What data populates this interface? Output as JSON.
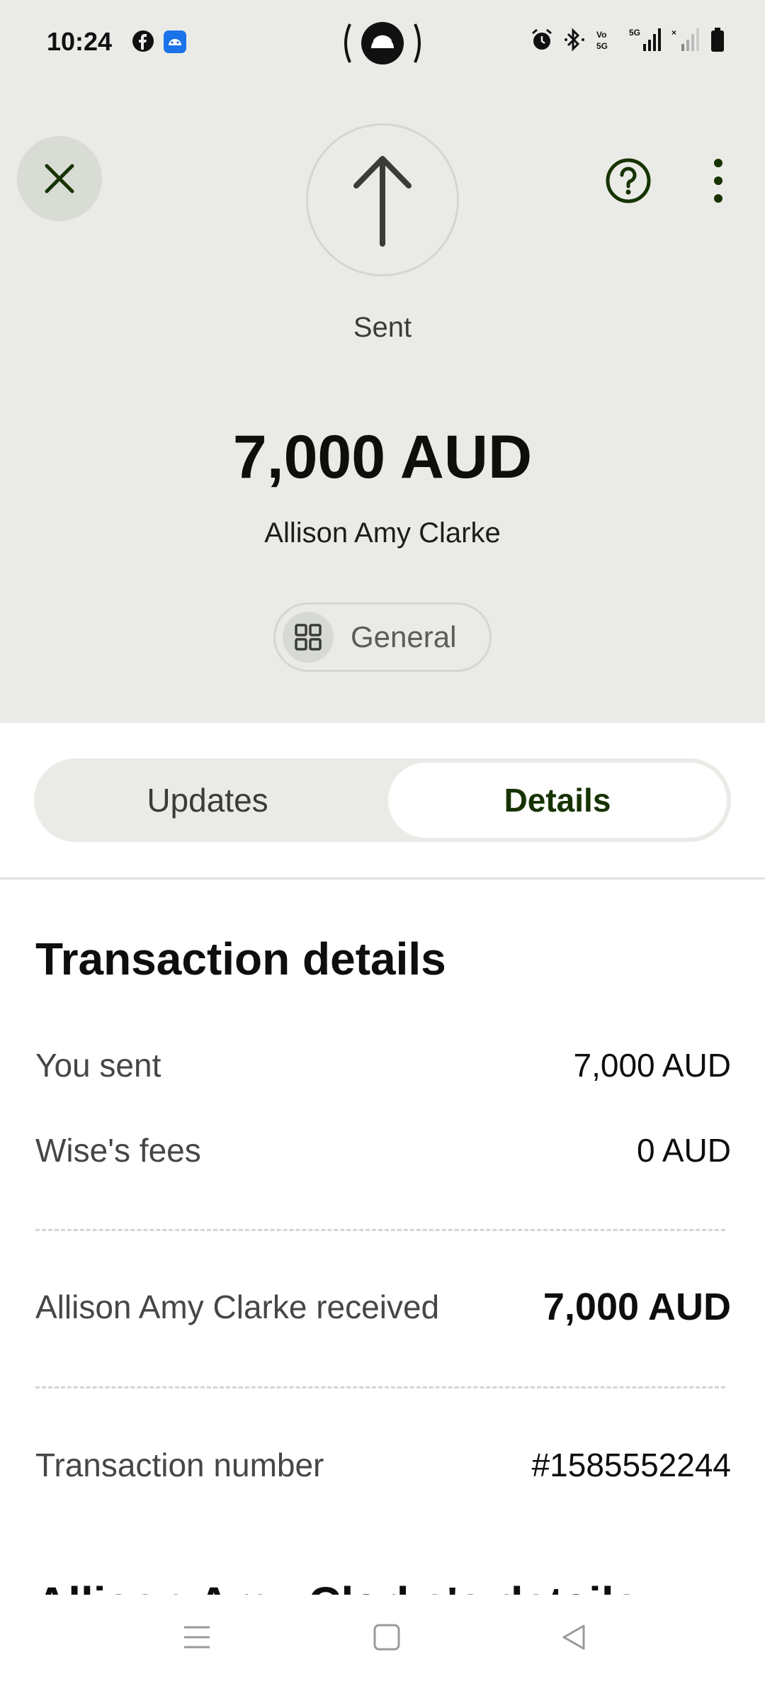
{
  "status_bar": {
    "time": "10:24",
    "icons": [
      "facebook-icon",
      "android-app-icon",
      "hotspot-icon",
      "alarm-icon",
      "bluetooth-icon",
      "volte-icon",
      "5g-signal-icon",
      "signal-icon",
      "battery-icon"
    ]
  },
  "header": {
    "status_label": "Sent",
    "amount": "7,000 AUD",
    "recipient": "Allison Amy Clarke",
    "category": "General"
  },
  "tabs": [
    {
      "label": "Updates",
      "selected": false
    },
    {
      "label": "Details",
      "selected": true
    }
  ],
  "details": {
    "title": "Transaction details",
    "rows": [
      {
        "label": "You sent",
        "value": "7,000 AUD"
      },
      {
        "label": "Wise's fees",
        "value": "0 AUD"
      },
      {
        "label": "Allison Amy Clarke received",
        "value": "7,000 AUD"
      },
      {
        "label": "Transaction number",
        "value": "#1585552244"
      }
    ],
    "next_heading": "Allison Amy Clarke's details"
  },
  "colors": {
    "header_bg": "#eaebe7",
    "accent": "#163300"
  }
}
